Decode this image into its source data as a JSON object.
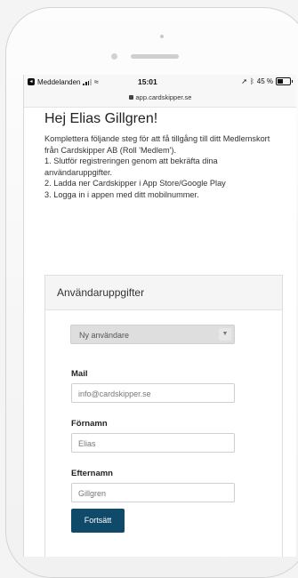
{
  "status_bar": {
    "app_back": "Meddelanden",
    "time": "15:01",
    "battery": "45 %",
    "battery_level": 0.45,
    "url": "app.cardskipper.se"
  },
  "page": {
    "greeting": "Hej Elias Gillgren!",
    "intro_lines": [
      "Komplettera följande steg för att få tillgång till ditt Medlemskort från Cardskipper AB (Roll 'Medlem').",
      "1. Slutför registreringen genom att bekräfta dina användaruppgifter.",
      "2. Ladda ner Cardskipper i App Store/Google Play",
      "3. Logga in i appen med ditt mobilnummer."
    ]
  },
  "form": {
    "panel_title": "Användaruppgifter",
    "user_select_value": "Ny användare",
    "mail_label": "Mail",
    "mail_value": "info@cardskipper.se",
    "firstname_label": "Förnamn",
    "firstname_value": "Elias",
    "lastname_label": "Efternamn",
    "lastname_value": "Gillgren",
    "submit_label": "Fortsätt"
  },
  "colors": {
    "button": "#0f4a6b",
    "panel_header": "#f5f5f5"
  },
  "icons": [
    "messages-app-icon",
    "signal-icon",
    "wifi-icon",
    "location-arrow-icon",
    "bluetooth-icon",
    "battery-icon",
    "lock-icon",
    "chevron-down-icon"
  ]
}
